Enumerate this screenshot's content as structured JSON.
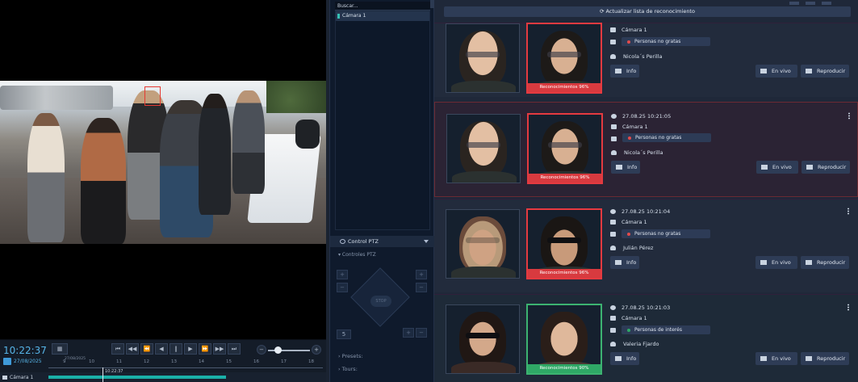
{
  "colors": {
    "accent_blue": "#56b3e6",
    "unwanted_red": "#d83a3f",
    "interest_green": "#2fa866",
    "panel_bg": "#1f2839"
  },
  "player": {
    "clock": "10:22:37",
    "date": "27/08/2025",
    "timeline_date": "27/08/2025",
    "timeline_ticks": [
      "9",
      "10",
      "11",
      "12",
      "13",
      "14",
      "15",
      "16",
      "17",
      "18"
    ],
    "playhead_label": "10:22:37",
    "camera_label": "Cámara 1",
    "buttons": [
      "◀◀",
      "◀",
      "‖",
      "▶",
      "▶▶"
    ]
  },
  "middle": {
    "search_placeholder": "Buscar...",
    "camera_item": "Cámara 1",
    "ptz_header": "Control PTZ",
    "ptz_sub": "Controles PTZ",
    "stop_label": "STOP",
    "speed_value": "5",
    "presets_label": "Presets:",
    "tours_label": "Tours:"
  },
  "right": {
    "refresh_label": "Actualizar lista de reconocimiento",
    "cards": [
      {
        "camera": "Cámara 1",
        "list": "Personas no gratas",
        "person": "Nicola´s Perilla",
        "match": "Reconocimientos 96%",
        "info_btn": "Info",
        "live_btn": "En vivo",
        "play_btn": "Reproducir"
      },
      {
        "time": "27.08.25 10:21:05",
        "camera": "Cámara 1",
        "list": "Personas no gratas",
        "person": "Nicola´s Perilla",
        "match": "Reconocimientos 96%",
        "info_btn": "Info",
        "live_btn": "En vivo",
        "play_btn": "Reproducir"
      },
      {
        "time": "27.08.25 10:21:04",
        "camera": "Cámara 1",
        "list": "Personas no gratas",
        "person": "Julián Pérez",
        "match": "Reconocimientos 96%",
        "info_btn": "Info",
        "live_btn": "En vivo",
        "play_btn": "Reproducir"
      },
      {
        "time": "27.08.25 10:21:03",
        "camera": "Cámara 1",
        "list": "Personas de interés",
        "person": "Valeria Fjardo",
        "match": "Reconocimientos 90%",
        "info_btn": "Info",
        "live_btn": "En vivo",
        "play_btn": "Reproducir"
      }
    ]
  }
}
